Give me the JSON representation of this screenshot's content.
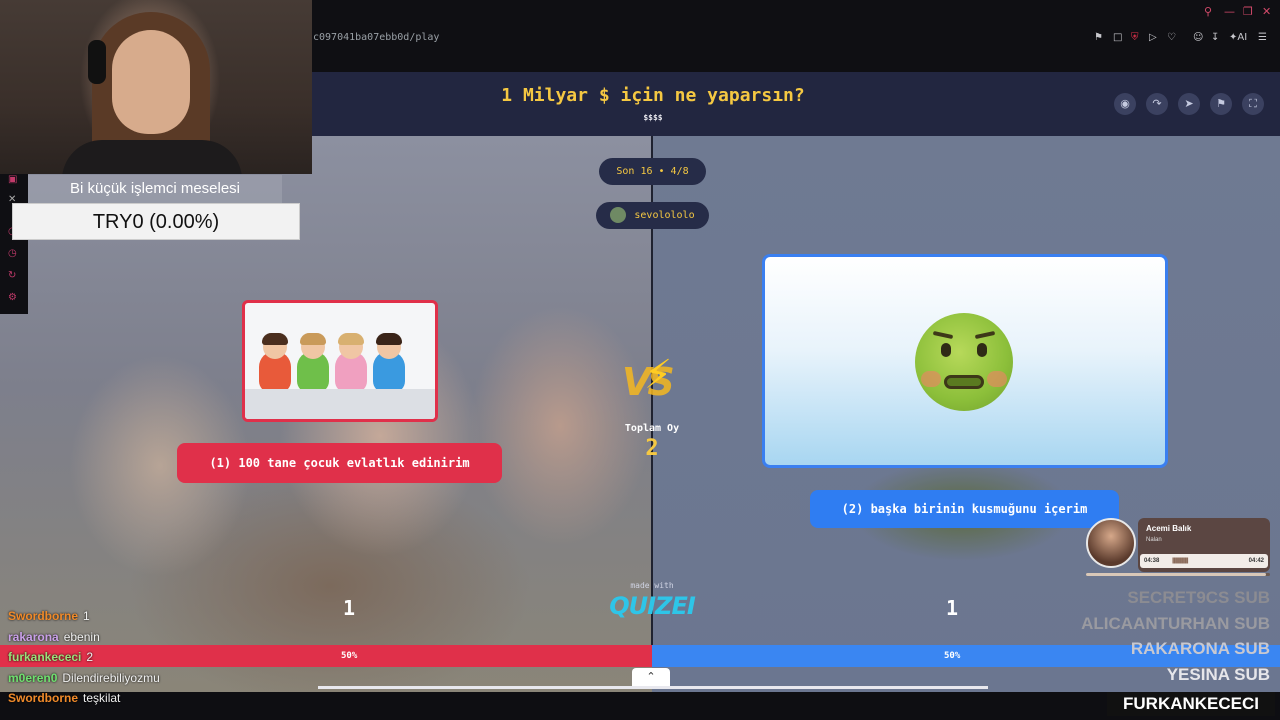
{
  "browser": {
    "url": "c097041ba07ebb0d/play",
    "window_controls": [
      "search-icon",
      "minimize-icon",
      "restore-icon",
      "close-icon"
    ],
    "toolbar_icons": [
      "pin-icon",
      "crop-icon",
      "shield-icon",
      "play-icon",
      "heart-icon",
      "user-icon",
      "download-icon",
      "ai-icon",
      "menu-icon"
    ],
    "toolbar_ai_label": "AI"
  },
  "quiz": {
    "title": "1 Milyar $ için ne yaparsın?",
    "subtitle": "$$$$",
    "round_label": "Son 16 • 4/8",
    "username": "sevolololo",
    "header_icons": [
      "eye-icon",
      "share-icon",
      "send-icon",
      "flag-icon",
      "fullscreen-icon"
    ],
    "option_left": {
      "label": "(1) 100 tane çocuk evlatlık edinirim",
      "votes": "1",
      "percent": "50%",
      "percent_value": 50,
      "color": "#e0304a"
    },
    "option_right": {
      "label": "(2) başka birinin kusmuğunu içerim",
      "votes": "1",
      "percent": "50%",
      "percent_value": 50,
      "color": "#3a86f2"
    },
    "vs_label": "VS",
    "total_votes_label": "Toplam Oy",
    "total_votes": "2",
    "made_with": "made with",
    "brand": "QUIZEI"
  },
  "overlay": {
    "streamer_title": "Bi küçük işlemci meselesi",
    "ticker": "TRY0 (0.00%)",
    "chat": [
      {
        "user": "Swordborne",
        "message": "1",
        "color": "#f08a2a"
      },
      {
        "user": "rakarona",
        "message": "ebenin",
        "color": "#c9a0e8"
      },
      {
        "user": "furkankececi",
        "message": "2",
        "color": "#9be07a"
      },
      {
        "user": "m0eren0",
        "message": "Dilendirebiliyozmu",
        "color": "#6fe06f"
      },
      {
        "user": "Swordborne",
        "message": "teşkilat",
        "color": "#f08a2a"
      }
    ],
    "music": {
      "title": "Acemi Balık",
      "artist": "Nalan",
      "time_current": "04:38",
      "time_total": "04:42",
      "progress": 0.98
    },
    "subs": [
      {
        "text": "SECRET9CS SUB",
        "color": "#8c8c92"
      },
      {
        "text": "ALICAANTURHAN SUB",
        "color": "#9a9aa0"
      },
      {
        "text": "RAKARONA SUB",
        "color": "#c8c8d0"
      },
      {
        "text": "YESINA SUB",
        "color": "#e6e6ea"
      }
    ],
    "latest_sub": "FURKANKECECI SUB"
  }
}
